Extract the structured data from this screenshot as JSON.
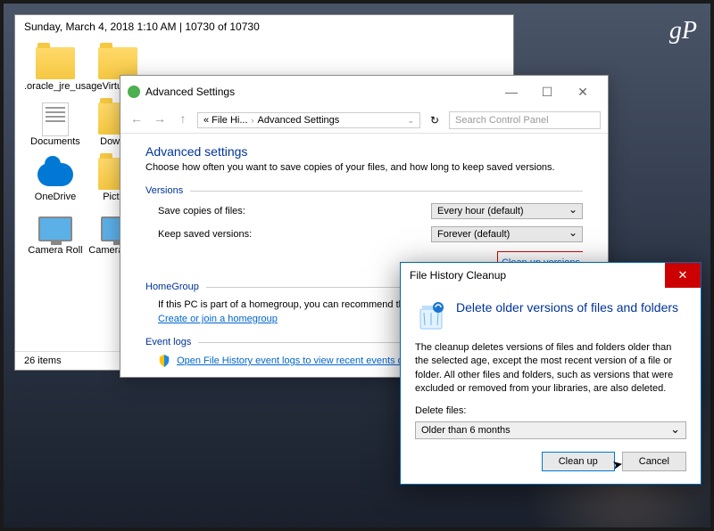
{
  "watermark": "gP",
  "explorer": {
    "header": "Sunday, March 4, 2018 1:10 AM   |   10730 of 10730",
    "items": [
      {
        "label": ".oracle_jre_usage",
        "type": "folder"
      },
      {
        "label": ".Virtua...",
        "type": "folder"
      },
      {
        "label": "Documents",
        "type": "doc"
      },
      {
        "label": "Downl...",
        "type": "folder"
      },
      {
        "label": "OneDrive",
        "type": "onedrive"
      },
      {
        "label": "Pictu...",
        "type": "folder"
      },
      {
        "label": "Camera Roll",
        "type": "computer"
      },
      {
        "label": "Camera Ro...",
        "type": "computer"
      }
    ],
    "status": "26 items"
  },
  "settings": {
    "title": "Advanced Settings",
    "breadcrumb": [
      "« File Hi...",
      "Advanced Settings"
    ],
    "search_placeholder": "Search Control Panel",
    "heading": "Advanced settings",
    "desc": "Choose how often you want to save copies of your files, and how long to keep saved versions.",
    "section_versions": "Versions",
    "save_copies_label": "Save copies of files:",
    "save_copies_value": "Every hour (default)",
    "keep_versions_label": "Keep saved versions:",
    "keep_versions_value": "Forever (default)",
    "cleanup_link": "Clean up versions",
    "section_homegroup": "HomeGroup",
    "homegroup_text": "If this PC is part of a homegroup, you can recommend this drive to other homegroup members.",
    "homegroup_link": "Create or join a homegroup",
    "section_eventlogs": "Event logs",
    "eventlogs_link": "Open File History event logs to view recent events or errors"
  },
  "dialog": {
    "title": "File History Cleanup",
    "heading": "Delete older versions of files and folders",
    "body": "The cleanup deletes versions of files and folders older than the selected age, except the most recent version of a file or folder. All other files and folders, such as versions that were excluded or removed from your libraries, are also deleted.",
    "delete_label": "Delete files:",
    "delete_value": "Older than 6 months",
    "btn_cleanup": "Clean up",
    "btn_cancel": "Cancel"
  }
}
